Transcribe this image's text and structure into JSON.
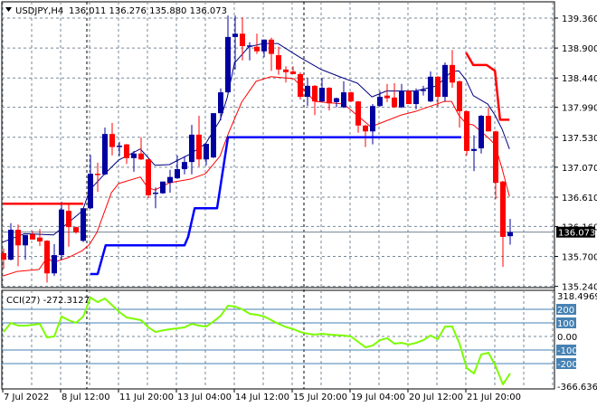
{
  "header": {
    "symbol": "USDJPY,H4",
    "ohlc": "136.011 136.276 135.880 136.073",
    "collapse_icon": "triangle-down-icon"
  },
  "colors": {
    "bull": "#0000A0",
    "bear": "#FF0000",
    "fast_ma": "#00007F",
    "slow_ma": "#FF0000",
    "lower_channel": "#0000FF",
    "upper_channel": "#FF0000",
    "cci": "#7CFC00",
    "level_line": "#4682B4",
    "grid": "#778899"
  },
  "chart_data": [
    {
      "type": "candlestick",
      "title": "USDJPY,H4",
      "ylim": [
        135.24,
        139.36
      ],
      "y_ticks": [
        "139.360",
        "138.900",
        "138.440",
        "137.990",
        "137.530",
        "137.070",
        "136.610",
        "136.160",
        "135.700",
        "135.240"
      ],
      "current_price": "136.073",
      "x_labels": [
        {
          "bar": 0,
          "label": "7 Jul 2022"
        },
        {
          "bar": 8,
          "label": "8 Jul 12:00"
        },
        {
          "bar": 16,
          "label": "11 Jul 20:00"
        },
        {
          "bar": 24,
          "label": "13 Jul 04:00"
        },
        {
          "bar": 32,
          "label": "14 Jul 12:00"
        },
        {
          "bar": 40,
          "label": "15 Jul 20:00"
        },
        {
          "bar": 48,
          "label": "19 Jul 04:00"
        },
        {
          "bar": 56,
          "label": "20 Jul 12:00"
        },
        {
          "bar": 64,
          "label": "21 Jul 20:00"
        }
      ],
      "separators": [
        11,
        41
      ],
      "candles": [
        [
          135.75,
          135.82,
          135.51,
          135.65
        ],
        [
          135.65,
          136.21,
          135.64,
          136.11
        ],
        [
          136.11,
          136.19,
          135.55,
          135.87
        ],
        [
          135.87,
          136.03,
          135.65,
          136.03
        ],
        [
          136.04,
          136.09,
          135.96,
          135.96
        ],
        [
          135.99,
          136.12,
          135.86,
          135.93
        ],
        [
          135.94,
          135.95,
          135.3,
          135.44
        ],
        [
          135.44,
          135.89,
          135.4,
          135.72
        ],
        [
          135.72,
          136.54,
          135.65,
          136.42
        ],
        [
          136.4,
          136.51,
          135.85,
          136.15
        ],
        [
          136.15,
          136.16,
          136.05,
          136.07
        ],
        [
          135.94,
          136.44,
          135.92,
          136.44
        ],
        [
          136.44,
          137.26,
          136.43,
          136.97
        ],
        [
          136.97,
          137.14,
          136.69,
          136.96
        ],
        [
          136.96,
          137.68,
          136.95,
          137.58
        ],
        [
          137.58,
          137.75,
          137.25,
          137.38
        ],
        [
          137.38,
          137.46,
          137.24,
          137.4
        ],
        [
          137.42,
          137.43,
          137.12,
          137.21
        ],
        [
          137.21,
          137.32,
          137.0,
          137.28
        ],
        [
          137.28,
          137.53,
          137.18,
          137.19
        ],
        [
          137.19,
          137.2,
          136.6,
          136.64
        ],
        [
          136.67,
          136.76,
          136.44,
          136.68
        ],
        [
          136.67,
          136.85,
          136.66,
          136.85
        ],
        [
          136.83,
          137.03,
          136.68,
          136.92
        ],
        [
          136.9,
          137.25,
          136.89,
          137.04
        ],
        [
          137.04,
          137.24,
          136.96,
          137.15
        ],
        [
          137.15,
          137.72,
          136.96,
          137.57
        ],
        [
          137.57,
          137.86,
          137.08,
          137.19
        ],
        [
          137.19,
          137.43,
          137.1,
          137.43
        ],
        [
          137.22,
          137.9,
          137.21,
          137.9
        ],
        [
          137.9,
          138.28,
          137.79,
          138.22
        ],
        [
          138.22,
          139.4,
          138.21,
          139.07
        ],
        [
          139.07,
          139.4,
          138.57,
          139.12
        ],
        [
          139.12,
          139.37,
          138.71,
          138.93
        ],
        [
          138.93,
          138.99,
          138.71,
          138.94
        ],
        [
          138.92,
          139.12,
          138.81,
          138.85
        ],
        [
          138.85,
          139.03,
          138.76,
          139.03
        ],
        [
          139.03,
          139.06,
          138.55,
          138.81
        ],
        [
          138.79,
          138.92,
          138.49,
          138.57
        ],
        [
          138.57,
          138.62,
          138.37,
          138.53
        ],
        [
          138.54,
          138.62,
          138.5,
          138.5
        ],
        [
          138.5,
          138.53,
          138.11,
          138.15
        ],
        [
          138.15,
          138.44,
          138.01,
          138.32
        ],
        [
          138.32,
          138.33,
          137.87,
          138.08
        ],
        [
          138.08,
          138.44,
          138.07,
          138.29
        ],
        [
          138.29,
          138.3,
          137.94,
          138.05
        ],
        [
          138.07,
          138.14,
          137.99,
          138.13
        ],
        [
          137.99,
          138.39,
          137.98,
          138.22
        ],
        [
          138.22,
          138.23,
          138.07,
          138.08
        ],
        [
          138.08,
          138.09,
          137.6,
          137.71
        ],
        [
          137.71,
          137.72,
          137.38,
          137.62
        ],
        [
          137.62,
          138.04,
          137.42,
          138.01
        ],
        [
          138.01,
          138.24,
          138.0,
          138.15
        ],
        [
          138.17,
          138.35,
          138.07,
          138.13
        ],
        [
          138.14,
          138.36,
          137.99,
          137.99
        ],
        [
          137.99,
          138.35,
          137.98,
          138.24
        ],
        [
          138.24,
          138.25,
          138.04,
          138.04
        ],
        [
          138.04,
          138.28,
          137.96,
          138.24
        ],
        [
          138.24,
          138.32,
          138.17,
          138.26
        ],
        [
          138.08,
          138.54,
          138.07,
          138.46
        ],
        [
          138.46,
          138.47,
          138.0,
          138.15
        ],
        [
          138.15,
          138.68,
          138.08,
          138.64
        ],
        [
          138.64,
          138.87,
          138.29,
          138.37
        ],
        [
          138.39,
          138.4,
          137.68,
          137.93
        ],
        [
          137.93,
          137.94,
          137.25,
          137.32
        ],
        [
          137.32,
          137.56,
          137.01,
          137.35
        ],
        [
          137.36,
          137.87,
          137.28,
          137.86
        ],
        [
          137.86,
          137.99,
          137.62,
          137.62
        ],
        [
          137.62,
          137.63,
          136.58,
          136.83
        ],
        [
          136.85,
          136.86,
          135.54,
          136.0
        ],
        [
          136.011,
          136.276,
          135.88,
          136.073
        ]
      ],
      "fast_ma": [
        [
          -0.1,
          135.92
        ],
        [
          2.9,
          136.05
        ],
        [
          6.9,
          136.03
        ],
        [
          10.9,
          136.4
        ],
        [
          11.9,
          136.72
        ],
        [
          13.9,
          136.96
        ],
        [
          15.9,
          137.18
        ],
        [
          18.9,
          137.35
        ],
        [
          20.9,
          137.1
        ],
        [
          22.9,
          137.11
        ],
        [
          25.9,
          137.28
        ],
        [
          27.9,
          137.43
        ],
        [
          29.9,
          137.79
        ],
        [
          30.9,
          138.14
        ],
        [
          31.9,
          138.67
        ],
        [
          33.9,
          138.92
        ],
        [
          35.9,
          138.97
        ],
        [
          37.9,
          138.97
        ],
        [
          40.9,
          138.76
        ],
        [
          43.9,
          138.57
        ],
        [
          46.9,
          138.44
        ],
        [
          48.9,
          138.36
        ],
        [
          50.9,
          138.15
        ],
        [
          52.9,
          138.24
        ],
        [
          56.9,
          138.24
        ],
        [
          59.9,
          138.32
        ],
        [
          61.9,
          138.54
        ],
        [
          62.9,
          138.55
        ],
        [
          63.9,
          138.41
        ],
        [
          64.9,
          138.17
        ],
        [
          66.9,
          138.04
        ],
        [
          67.9,
          137.87
        ],
        [
          68.9,
          137.65
        ],
        [
          69.9,
          137.35
        ]
      ],
      "slow_ma": [
        [
          -0.1,
          135.4
        ],
        [
          1.9,
          135.47
        ],
        [
          4.9,
          135.5
        ],
        [
          6,
          135.68
        ],
        [
          6.9,
          135.61
        ],
        [
          8.9,
          135.68
        ],
        [
          10.9,
          135.79
        ],
        [
          11.9,
          135.89
        ],
        [
          12.9,
          136.07
        ],
        [
          14.9,
          136.68
        ],
        [
          15.9,
          136.82
        ],
        [
          18.9,
          136.92
        ],
        [
          19.9,
          136.76
        ],
        [
          20.9,
          136.72
        ],
        [
          22.9,
          136.83
        ],
        [
          25.9,
          136.89
        ],
        [
          27.9,
          136.97
        ],
        [
          29.9,
          137.24
        ],
        [
          31.1,
          137.6
        ],
        [
          32.9,
          138.07
        ],
        [
          34.9,
          138.39
        ],
        [
          36.9,
          138.46
        ],
        [
          40.1,
          138.43
        ],
        [
          43,
          138.08
        ],
        [
          47,
          138.04
        ],
        [
          50.75,
          137.69
        ],
        [
          54.9,
          137.87
        ],
        [
          57,
          137.93
        ],
        [
          60.9,
          138.08
        ],
        [
          61.9,
          138.08
        ],
        [
          62.9,
          137.87
        ],
        [
          63.9,
          137.74
        ],
        [
          64.9,
          137.72
        ],
        [
          66.9,
          137.53
        ],
        [
          67.9,
          137.42
        ],
        [
          68.9,
          137.04
        ],
        [
          69.9,
          136.62
        ]
      ],
      "lower_channel": [
        [
          12,
          135.43
        ],
        [
          13,
          135.43
        ],
        [
          14.1,
          135.87
        ],
        [
          25,
          135.87
        ],
        [
          25.5,
          136.0
        ],
        [
          26.4,
          136.44
        ],
        [
          29.5,
          136.44
        ],
        [
          31,
          137.53
        ],
        [
          63.25,
          137.53
        ]
      ],
      "upper_channel_left": [
        [
          -0.1,
          136.51
        ],
        [
          11,
          136.51
        ]
      ],
      "upper_channel_right": [
        [
          63.9,
          138.83
        ],
        [
          64.9,
          138.64
        ],
        [
          66.75,
          138.64
        ],
        [
          67.9,
          138.55
        ],
        [
          68.6,
          137.8
        ],
        [
          69.9,
          137.8
        ]
      ]
    },
    {
      "type": "line",
      "title": "CCI(27) -272.3127",
      "ylim": [
        -366.6365,
        318.4969
      ],
      "y_ticks": [
        "318.4969",
        "0.00",
        "-366.6365"
      ],
      "levels": [
        "200",
        "100",
        "-100",
        "-200"
      ],
      "values": [
        33,
        100,
        80,
        80,
        85,
        93,
        -7,
        0,
        147,
        120,
        100,
        147,
        287,
        253,
        280,
        230,
        180,
        140,
        130,
        120,
        67,
        33,
        45,
        53,
        60,
        67,
        93,
        80,
        73,
        110,
        153,
        227,
        220,
        200,
        167,
        160,
        147,
        120,
        93,
        70,
        55,
        33,
        20,
        13,
        20,
        13,
        10,
        7,
        0,
        -40,
        -80,
        -67,
        -27,
        -13,
        -53,
        -47,
        -60,
        -47,
        -27,
        7,
        -20,
        73,
        73,
        -53,
        -233,
        -273,
        -133,
        -120,
        -220,
        -353,
        -272.3127
      ]
    }
  ]
}
